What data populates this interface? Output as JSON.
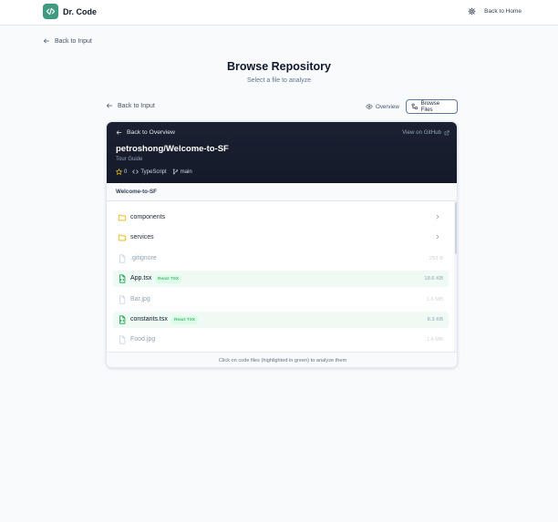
{
  "header": {
    "brand": "Dr. Code",
    "back_home": "Back to Home"
  },
  "nav": {
    "back_to_input": "Back to Input"
  },
  "page": {
    "title": "Browse Repository",
    "subtitle": "Select a file to analyze"
  },
  "view_toggle": {
    "overview": "Overview",
    "browse_files": "Browse Files",
    "active": "browse_files"
  },
  "repo": {
    "back_to_overview": "Back to Overview",
    "view_on_github": "View on GitHub",
    "full_name": "petroshong/Welcome-to-SF",
    "description": "Tour Guide",
    "stars": "0",
    "language": "TypeScript",
    "branch": "main"
  },
  "browser": {
    "breadcrumb": "Welcome-to-SF",
    "items": [
      {
        "name": "components",
        "type": "folder"
      },
      {
        "name": "services",
        "type": "folder"
      },
      {
        "name": ".gitignore",
        "type": "file",
        "size": "253 B"
      },
      {
        "name": "App.tsx",
        "type": "code",
        "badge": "React TSX",
        "size": "18.6 KB"
      },
      {
        "name": "Bar.jpg",
        "type": "file",
        "size": "1.6 MB"
      },
      {
        "name": "constants.tsx",
        "type": "code",
        "badge": "React TSX",
        "size": "8.3 KB"
      },
      {
        "name": "Food.jpg",
        "type": "file",
        "size": "1.4 MB"
      }
    ],
    "footer_hint": "Click on code files (highlighted in green) to analyze them"
  },
  "colors": {
    "brand": "#3f9a7f",
    "dark_header": "#1b2132",
    "code_highlight": "#eefaf3",
    "badge_text": "#16a34a",
    "folder_icon": "#eab308",
    "star_icon": "#facc15"
  },
  "icons": {
    "logo": "code-brackets-icon",
    "settings": "gear-icon",
    "back": "arrow-left-icon",
    "overview": "eye-icon",
    "browse": "folder-tree-icon",
    "external": "external-link-icon",
    "star": "star-icon",
    "language": "code-icon",
    "branch": "git-branch-icon",
    "folder": "folder-icon",
    "file": "file-icon",
    "code_file": "file-code-icon",
    "chevron": "chevron-right-icon"
  }
}
